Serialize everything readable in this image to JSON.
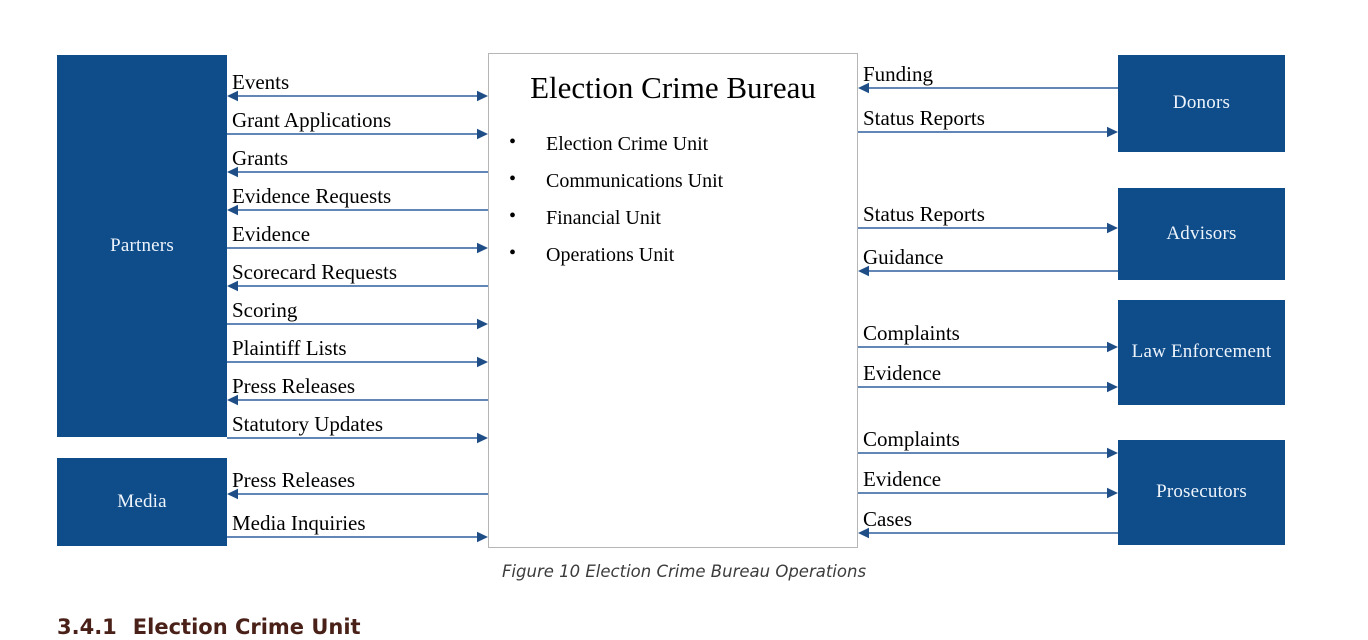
{
  "figure": {
    "caption": "Figure 10 Election Crime Bureau Operations",
    "accent_color": "#0e4c8a",
    "arrow_color": "#2e5f9e",
    "arrowhead_color": "#1f4e87",
    "box_text_color": "#eef4fb",
    "caption_color": "#3c3c3c",
    "heading_color": "#4a2118"
  },
  "center": {
    "title": "Election Crime Bureau",
    "units": [
      "Election Crime Unit",
      "Communications Unit",
      "Financial Unit",
      "Operations Unit"
    ]
  },
  "entities": {
    "partners": "Partners",
    "media": "Media",
    "donors": "Donors",
    "advisors": "Advisors",
    "law_enforcement": "Law Enforcement",
    "prosecutors": "Prosecutors"
  },
  "flows": {
    "partners": [
      {
        "label": "Events",
        "direction": "both"
      },
      {
        "label": "Grant Applications",
        "direction": "right"
      },
      {
        "label": "Grants",
        "direction": "left"
      },
      {
        "label": "Evidence Requests",
        "direction": "left"
      },
      {
        "label": "Evidence",
        "direction": "right"
      },
      {
        "label": "Scorecard Requests",
        "direction": "left"
      },
      {
        "label": "Scoring",
        "direction": "right"
      },
      {
        "label": "Plaintiff Lists",
        "direction": "right"
      },
      {
        "label": "Press Releases",
        "direction": "left"
      },
      {
        "label": "Statutory Updates",
        "direction": "right"
      }
    ],
    "media": [
      {
        "label": "Press Releases",
        "direction": "left"
      },
      {
        "label": "Media Inquiries",
        "direction": "right"
      }
    ],
    "donors": [
      {
        "label": "Funding",
        "direction": "left"
      },
      {
        "label": "Status Reports",
        "direction": "right"
      }
    ],
    "advisors": [
      {
        "label": "Status Reports",
        "direction": "right"
      },
      {
        "label": "Guidance",
        "direction": "left"
      }
    ],
    "law_enforcement": [
      {
        "label": "Complaints",
        "direction": "right"
      },
      {
        "label": "Evidence",
        "direction": "right"
      }
    ],
    "prosecutors": [
      {
        "label": "Complaints",
        "direction": "right"
      },
      {
        "label": "Evidence",
        "direction": "right"
      },
      {
        "label": "Cases",
        "direction": "left"
      }
    ]
  },
  "section": {
    "number": "3.4.1",
    "title": "Election Crime Unit"
  }
}
